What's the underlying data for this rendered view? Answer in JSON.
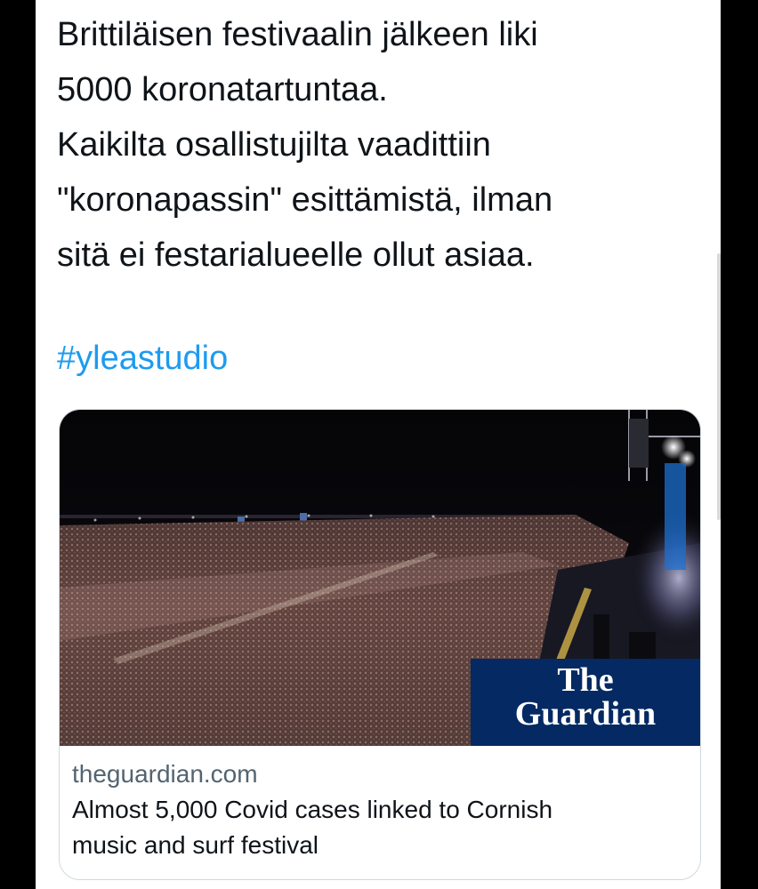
{
  "tweet": {
    "text_lines": [
      "Brittiläisen festivaalin jälkeen liki",
      "5000 koronatartuntaa.",
      "Kaikilta osallistujilta vaadittiin",
      "\"koronapassin\" esittämistä, ilman",
      "sitä ei festarialueelle ollut asiaa."
    ],
    "hashtag": "#yleastudio"
  },
  "link_card": {
    "image": "festival-crowd-night-photo",
    "badge": {
      "line1": "The",
      "line2": "Guardian"
    },
    "domain": "theguardian.com",
    "title_lines": [
      "Almost 5,000 Covid cases linked to Cornish",
      "music and surf festival"
    ]
  },
  "colors": {
    "text": "#0f1419",
    "hashtag": "#1d9bf0",
    "secondary": "#536471",
    "guardian_blue": "#052962"
  }
}
